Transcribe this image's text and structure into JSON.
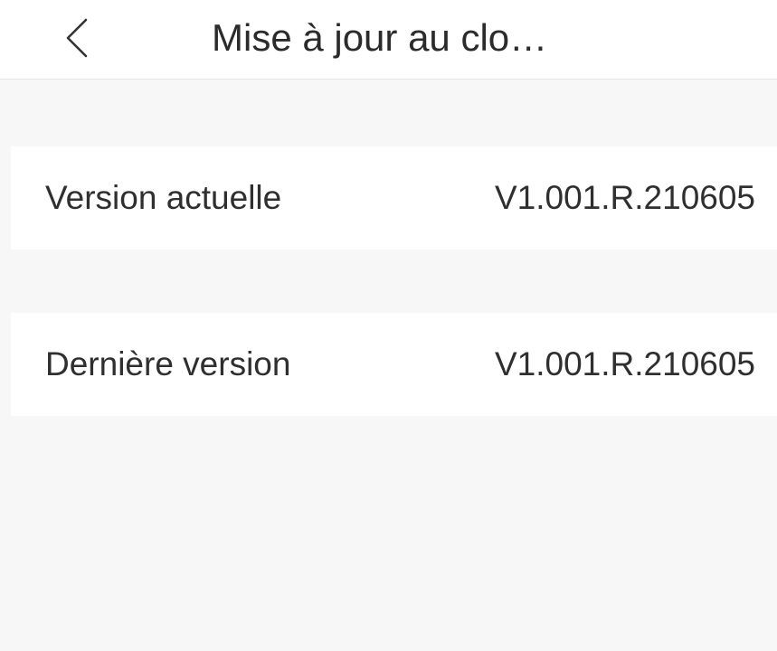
{
  "header": {
    "back_icon": "chevron-left-icon",
    "title": "Mise à jour au clo…"
  },
  "versions": [
    {
      "label": "Version actuelle",
      "value": "V1.001.R.210605"
    },
    {
      "label": "Dernière version",
      "value": "V1.001.R.210605"
    }
  ],
  "colors": {
    "background": "#f7f7f7",
    "surface": "#ffffff",
    "text": "#2f2f2f",
    "divider": "#e6e6e6"
  }
}
